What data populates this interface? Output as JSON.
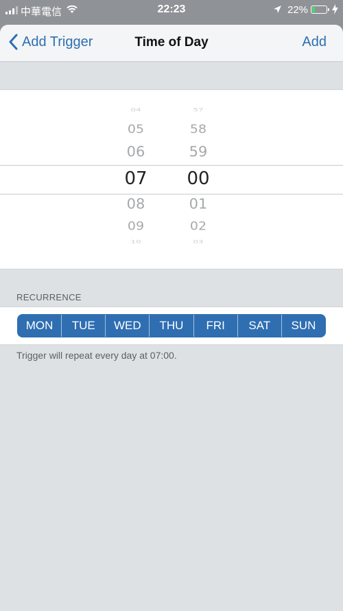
{
  "status_bar": {
    "carrier": "中華電信",
    "time": "22:23",
    "battery_percent": "22%",
    "battery_level": 0.22,
    "battery_color": "#4cd964"
  },
  "nav": {
    "back_label": "Add Trigger",
    "title": "Time of Day",
    "action_label": "Add",
    "accent_color": "#2d6fb0"
  },
  "picker": {
    "hours": [
      "04",
      "05",
      "06",
      "07",
      "08",
      "09",
      "10"
    ],
    "minutes": [
      "57",
      "58",
      "59",
      "00",
      "01",
      "02",
      "03"
    ],
    "selected_hour": "07",
    "selected_minute": "00"
  },
  "recurrence": {
    "section_label": "RECURRENCE",
    "days": [
      "MON",
      "TUE",
      "WED",
      "THU",
      "FRI",
      "SAT",
      "SUN"
    ],
    "all_selected": true,
    "selected_color": "#2f6eb1",
    "summary": "Trigger will repeat every day at 07:00."
  }
}
